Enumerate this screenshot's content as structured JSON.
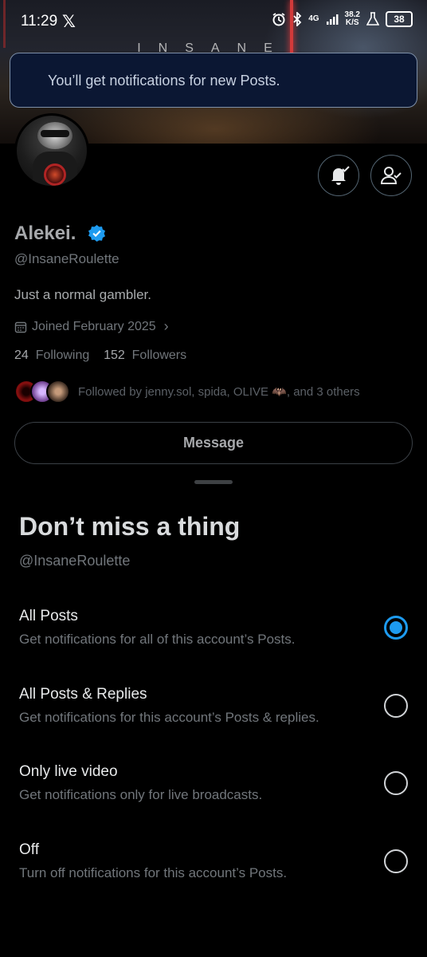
{
  "status_bar": {
    "time": "11:29",
    "network": "4G",
    "speed_value": "38.2",
    "speed_unit": "K/S",
    "battery": "38"
  },
  "banner": {
    "text": "INSANE"
  },
  "toast": {
    "message": "You’ll get notifications for new Posts."
  },
  "profile": {
    "name": "Alekei.",
    "handle": "@InsaneRoulette",
    "bio": "Just a normal gambler.",
    "joined": "Joined February 2025",
    "following_count": "24",
    "following_label": "Following",
    "followers_count": "152",
    "followers_label": "Followers",
    "followed_by": "Followed by jenny.sol, spida, OLIVE 🦇, and 3 others",
    "message_button": "Message"
  },
  "sheet": {
    "title": "Don’t miss a thing",
    "handle": "@InsaneRoulette",
    "options": [
      {
        "title": "All Posts",
        "desc": "Get notifications for all of this account’s Posts.",
        "selected": true
      },
      {
        "title": "All Posts & Replies",
        "desc": "Get notifications for this account’s Posts & replies.",
        "selected": false
      },
      {
        "title": "Only live video",
        "desc": "Get notifications only for live broadcasts.",
        "selected": false
      },
      {
        "title": "Off",
        "desc": "Turn off notifications for this account’s Posts.",
        "selected": false
      }
    ]
  },
  "colors": {
    "accent": "#1d9bf0",
    "toast_bg": "#0b1733",
    "background": "#000000"
  }
}
